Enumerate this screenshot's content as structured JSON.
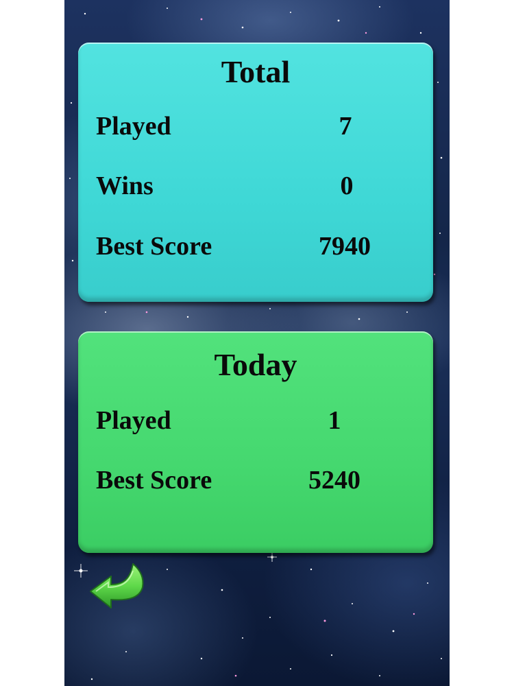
{
  "total": {
    "title": "Total",
    "rows": [
      {
        "label": "Played",
        "value": "7"
      },
      {
        "label": "Wins",
        "value": "0"
      },
      {
        "label": "Best Score",
        "value": "7940"
      }
    ]
  },
  "today": {
    "title": "Today",
    "rows": [
      {
        "label": "Played",
        "value": "1"
      },
      {
        "label": "Best Score",
        "value": "5240"
      }
    ]
  },
  "back": {
    "icon": "back-arrow-icon"
  },
  "colors": {
    "total_panel": "#45dcd9",
    "today_panel": "#48da72",
    "back_arrow": "#5fd94a",
    "text": "#0a0a0a"
  }
}
